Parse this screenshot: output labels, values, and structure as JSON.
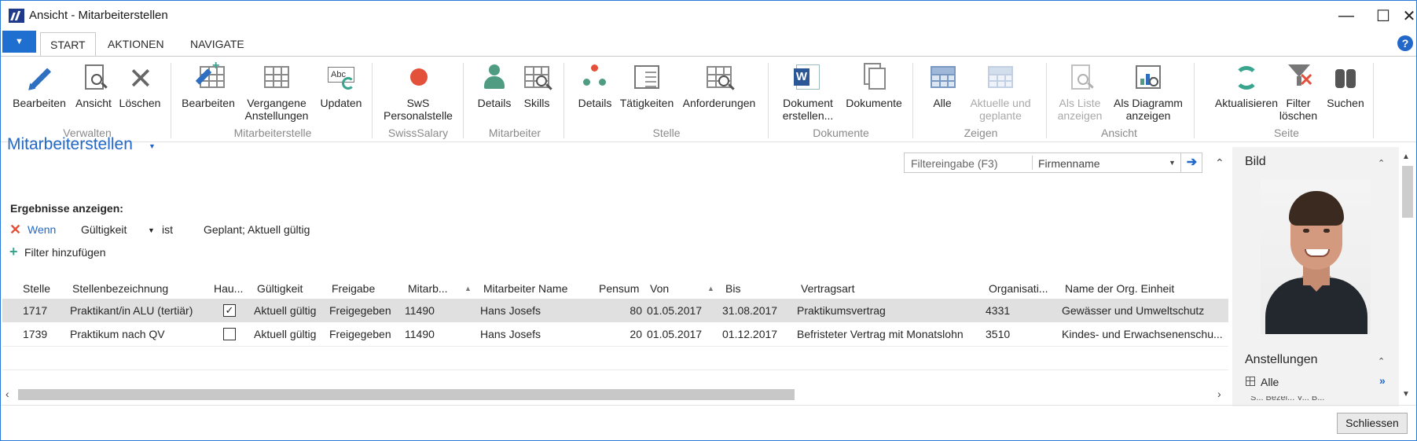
{
  "window": {
    "title": "Ansicht - Mitarbeiterstellen",
    "minimize": "—",
    "maximize": "☐",
    "close": "✕"
  },
  "ribbon_tabs": {
    "app_menu": "▼",
    "tabs": [
      "START",
      "AKTIONEN",
      "NAVIGATE"
    ],
    "help": "?"
  },
  "ribbon": {
    "verwalten": {
      "label": "Verwalten",
      "bearbeiten": "Bearbeiten",
      "ansicht": "Ansicht",
      "loeschen": "Löschen"
    },
    "mitarbeiterstelle": {
      "label": "Mitarbeiterstelle",
      "bearbeiten": "Bearbeiten",
      "vergangene_1": "Vergangene",
      "vergangene_2": "Anstellungen",
      "updaten": "Updaten"
    },
    "swisssalary": {
      "label": "SwissSalary",
      "sws_1": "SwS",
      "sws_2": "Personalstelle"
    },
    "mitarbeiter": {
      "label": "Mitarbeiter",
      "details": "Details",
      "skills": "Skills"
    },
    "stelle": {
      "label": "Stelle",
      "details": "Details",
      "taetigkeiten": "Tätigkeiten",
      "anforderungen": "Anforderungen"
    },
    "dokumente": {
      "label": "Dokumente",
      "dok_erstellen_1": "Dokument",
      "dok_erstellen_2": "erstellen...",
      "dokumente": "Dokumente"
    },
    "zeigen": {
      "label": "Zeigen",
      "alle": "Alle",
      "aktuelle_1": "Aktuelle und",
      "aktuelle_2": "geplante"
    },
    "ansicht": {
      "label": "Ansicht",
      "liste_1": "Als Liste",
      "liste_2": "anzeigen",
      "diagramm_1": "Als Diagramm",
      "diagramm_2": "anzeigen"
    },
    "seite": {
      "label": "Seite",
      "aktualisieren": "Aktualisieren",
      "filter_1": "Filter",
      "filter_2": "löschen",
      "suchen": "Suchen"
    }
  },
  "page": {
    "title": "Mitarbeiterstellen",
    "title_caret": "▼",
    "filter_placeholder": "Filtereingabe (F3)",
    "filter_field": "Firmenname",
    "filter_caret": "▼",
    "filter_go": "➔",
    "collapse": "⌃"
  },
  "filters": {
    "heading": "Ergebnisse anzeigen:",
    "remove": "✕",
    "condition": "Wenn",
    "field": "Gültigkeit",
    "field_caret": "▼",
    "operator": "ist",
    "value": "Geplant; Aktuell gültig",
    "add_plus": "+",
    "add_label": "Filter hinzufügen"
  },
  "table": {
    "columns": {
      "stelle": "Stelle",
      "bezeichnung": "Stellenbezeichnung",
      "haupt": "Hau...",
      "gueltigkeit": "Gültigkeit",
      "freigabe": "Freigabe",
      "mitarb": "Mitarb...",
      "mitarb_sort": "▲",
      "name": "Mitarbeiter Name",
      "pensum": "Pensum",
      "von": "Von",
      "von_sort": "▲",
      "bis": "Bis",
      "vertragsart": "Vertragsart",
      "org": "Organisati...",
      "org_name": "Name der Org. Einheit"
    },
    "rows": [
      {
        "stelle": "1717",
        "bezeichnung": "Praktikant/in ALU (tertiär)",
        "haupt": "✓",
        "gueltigkeit": "Aktuell gültig",
        "freigabe": "Freigegeben",
        "mitarb": "11490",
        "name": "Hans Josefs",
        "pensum": "80",
        "von": "01.05.2017",
        "bis": "31.08.2017",
        "vertragsart": "Praktikumsvertrag",
        "org": "4331",
        "org_name": "Gewässer und Umweltschutz"
      },
      {
        "stelle": "1739",
        "bezeichnung": "Praktikum nach QV",
        "haupt": "",
        "gueltigkeit": "Aktuell gültig",
        "freigabe": "Freigegeben",
        "mitarb": "11490",
        "name": "Hans Josefs",
        "pensum": "20",
        "von": "01.05.2017",
        "bis": "01.12.2017",
        "vertragsart": "Befristeter Vertrag mit Monatslohn",
        "org": "3510",
        "org_name": "Kindes- und Erwachsenenschu..."
      }
    ],
    "scroll_left": "‹",
    "scroll_right": "›"
  },
  "factbox": {
    "bild_title": "Bild",
    "bild_caret": "⌃",
    "anstellungen_title": "Anstellungen",
    "anstellungen_caret": "⌃",
    "item": "Alle",
    "more": "»",
    "truncated_header": "S... Bezei... V... B..."
  },
  "vscroll": {
    "up": "▲",
    "down": "▼"
  },
  "footer": {
    "close_button": "Schliessen"
  },
  "colors": {
    "accent": "#2268c9",
    "app_menu": "#1e6fd0",
    "selected_row": "#e0e0e0"
  }
}
